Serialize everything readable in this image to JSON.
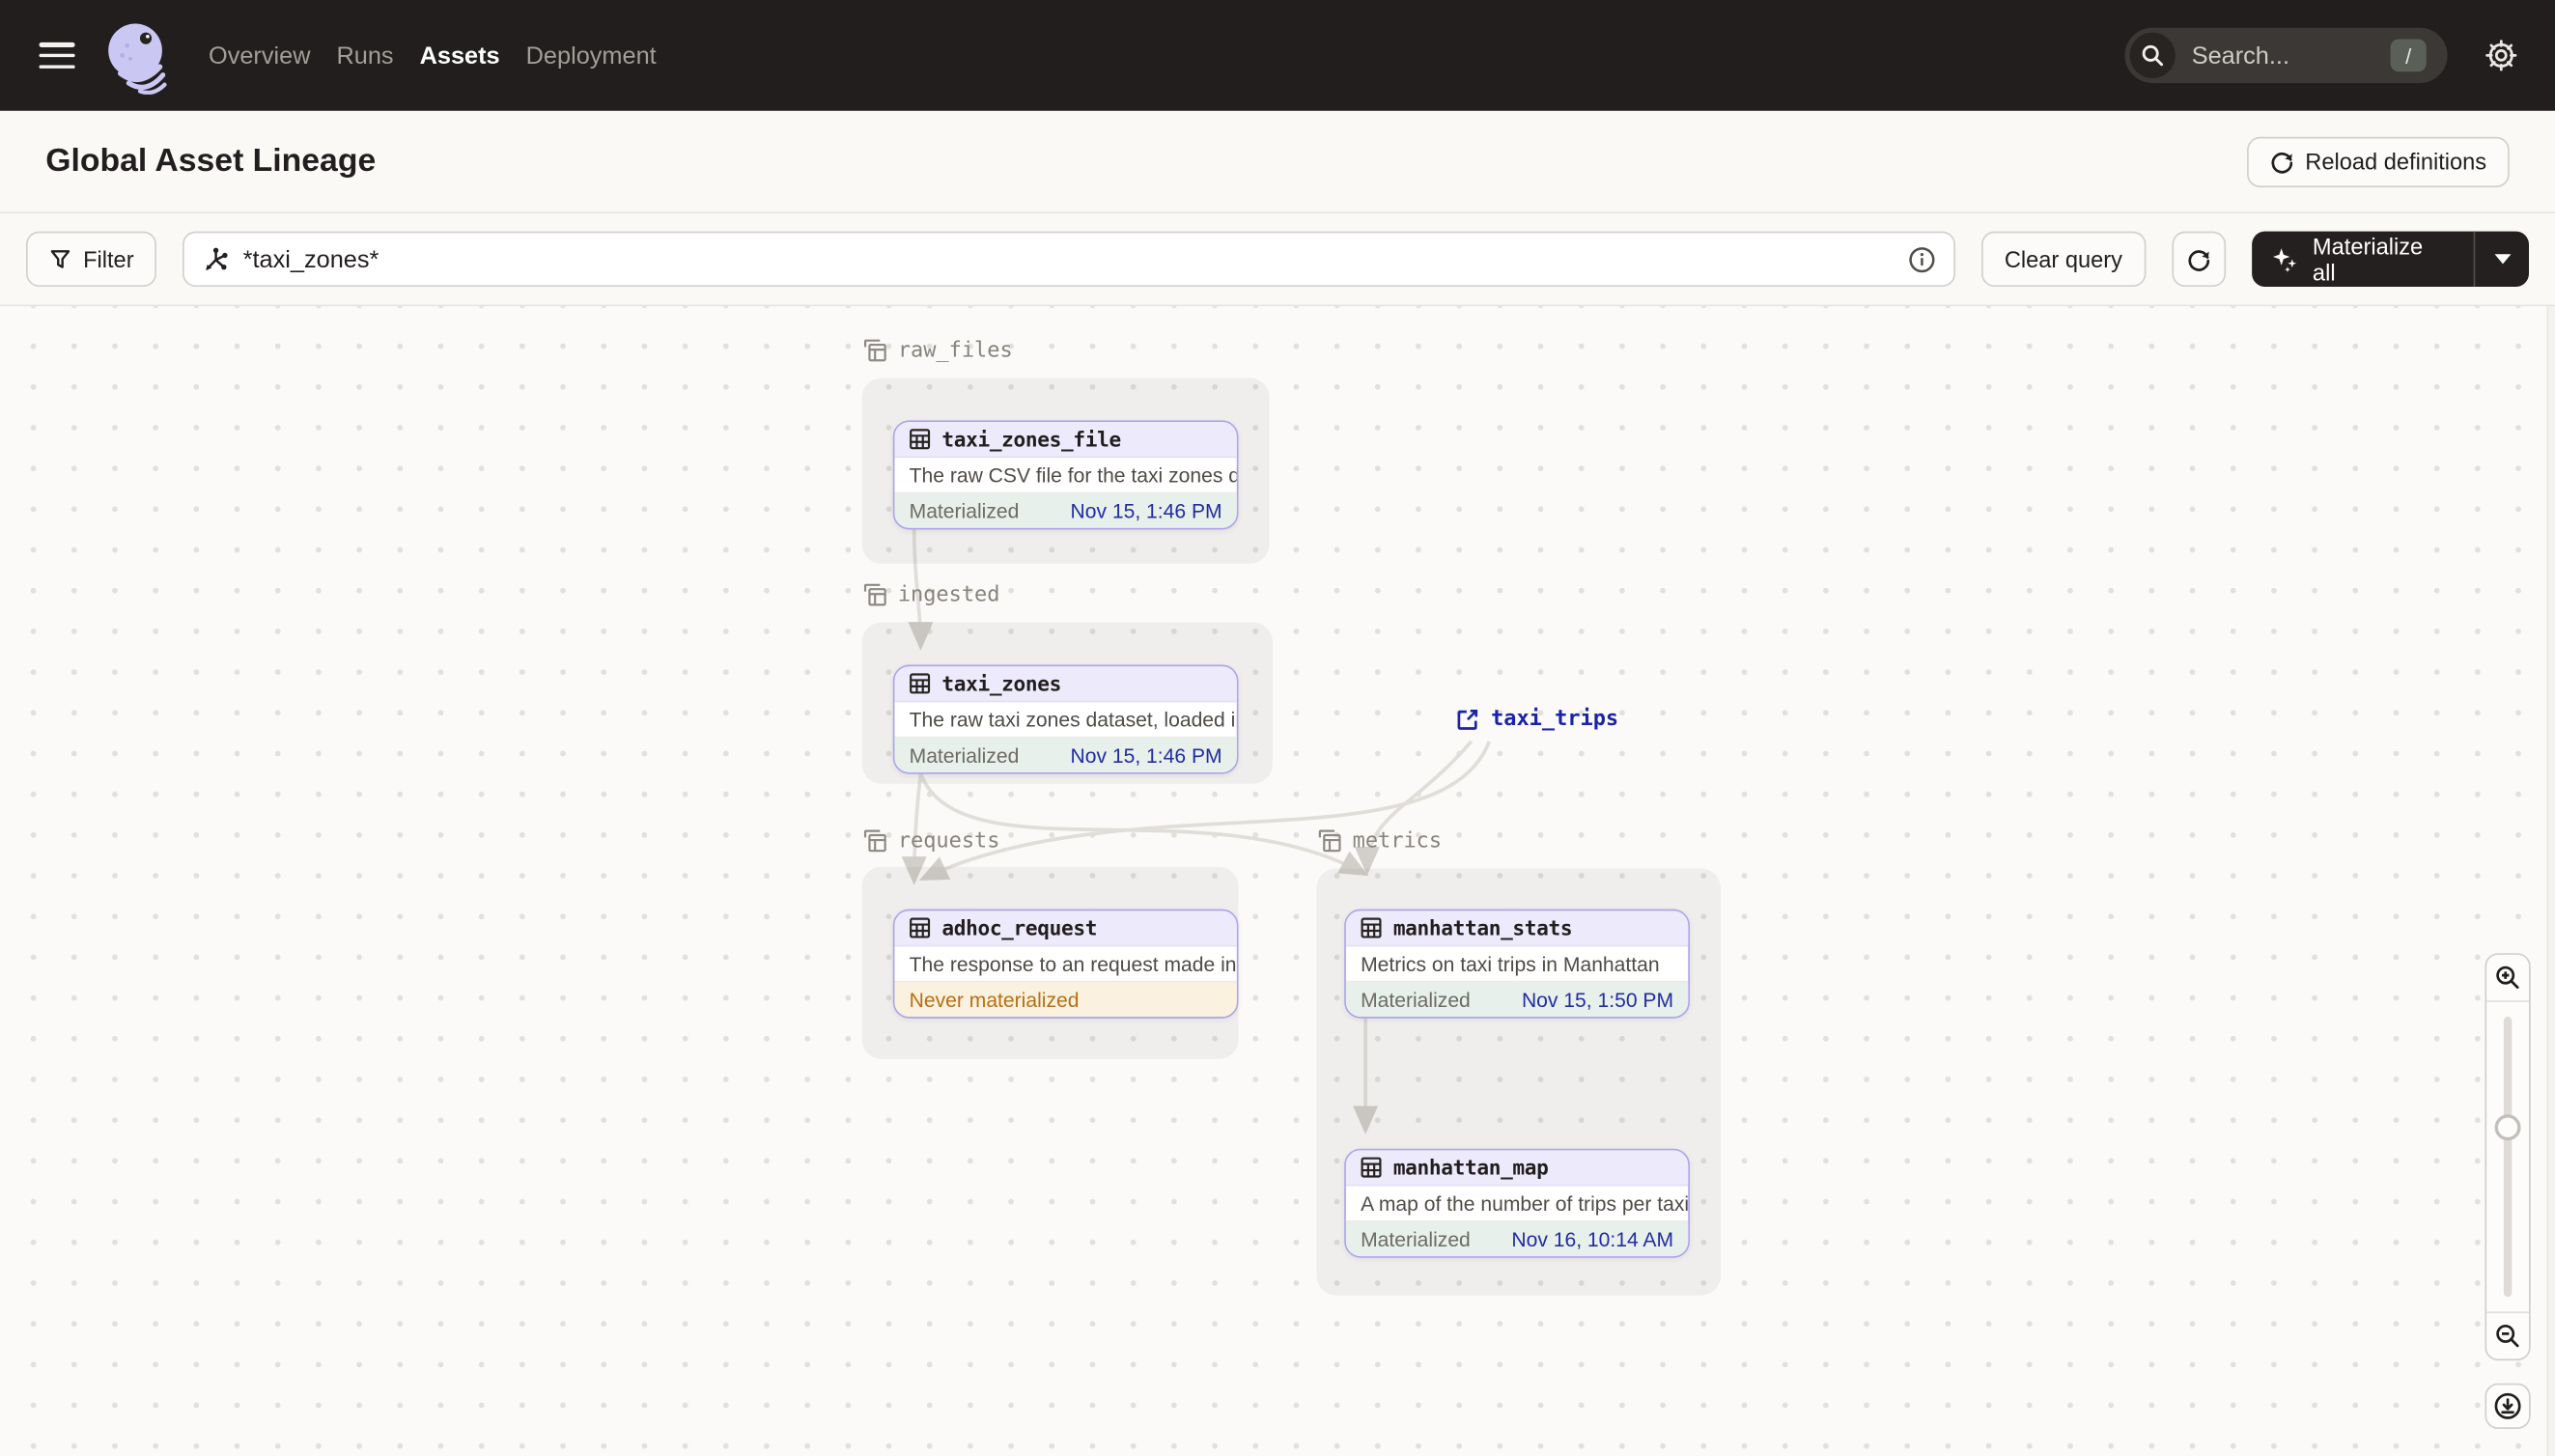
{
  "nav": {
    "items": [
      {
        "label": "Overview",
        "active": false
      },
      {
        "label": "Runs",
        "active": false
      },
      {
        "label": "Assets",
        "active": true
      },
      {
        "label": "Deployment",
        "active": false
      }
    ],
    "search": {
      "placeholder": "Search...",
      "shortcut_key": "/"
    }
  },
  "header": {
    "title": "Global Asset Lineage",
    "reload_button_label": "Reload definitions"
  },
  "toolbar": {
    "filter_button_label": "Filter",
    "query_value": "*taxi_zones*",
    "clear_button_label": "Clear query",
    "materialize_button_label": "Materialize all"
  },
  "graph": {
    "groups": [
      {
        "label": "raw_files"
      },
      {
        "label": "ingested"
      },
      {
        "label": "requests"
      },
      {
        "label": "metrics"
      }
    ],
    "assets": [
      {
        "name": "taxi_zones_file",
        "group": "raw_files",
        "description": "The raw CSV file for the taxi zones dat...",
        "status": "Materialized",
        "timestamp": "Nov 15, 1:46 PM",
        "state": "materialized"
      },
      {
        "name": "taxi_zones",
        "group": "ingested",
        "description": "The raw taxi zones dataset, loaded int...",
        "status": "Materialized",
        "timestamp": "Nov 15, 1:46 PM",
        "state": "materialized"
      },
      {
        "name": "adhoc_request",
        "group": "requests",
        "description": "The response to an request made in th...",
        "status": "Never materialized",
        "timestamp": "",
        "state": "never"
      },
      {
        "name": "manhattan_stats",
        "group": "metrics",
        "description": "Metrics on taxi trips in Manhattan",
        "status": "Materialized",
        "timestamp": "Nov 15, 1:50 PM",
        "state": "materialized"
      },
      {
        "name": "manhattan_map",
        "group": "metrics",
        "description": "A map of the number of trips per taxi z...",
        "status": "Materialized",
        "timestamp": "Nov 16, 10:14 AM",
        "state": "materialized"
      }
    ],
    "external_assets": [
      {
        "name": "taxi_trips"
      }
    ],
    "edges": [
      {
        "from": "taxi_zones_file",
        "to": "taxi_zones"
      },
      {
        "from": "taxi_zones",
        "to": "adhoc_request"
      },
      {
        "from": "taxi_zones",
        "to": "manhattan_stats"
      },
      {
        "from": "taxi_trips",
        "to": "adhoc_request"
      },
      {
        "from": "taxi_trips",
        "to": "manhattan_stats"
      },
      {
        "from": "manhattan_stats",
        "to": "manhattan_map"
      }
    ]
  },
  "icons": {
    "menu": "hamburger",
    "logo": "dagster-octopus",
    "search": "magnifier",
    "settings": "gear",
    "reload": "refresh-arrow",
    "filter": "funnel",
    "query": "asset-graph",
    "info": "info-circle",
    "refresh": "refresh-arrow",
    "materialize": "sparkle",
    "expand": "caret-down",
    "group": "stacked-tables",
    "asset": "table-grid",
    "external": "external-link",
    "zoom_in": "magnifier-plus",
    "zoom_out": "magnifier-minus",
    "export": "download-circle"
  },
  "colors": {
    "nav_bg": "#211E1D",
    "page_bg": "#FAF9F6",
    "canvas_bg": "#FBFAF8",
    "node_border": "#ACA5E9",
    "node_header_bg": "#EDEBFB",
    "materialized_bg": "#E7F0EA",
    "never_materialized_bg": "#FAF1DE",
    "timestamp_text": "#222CA3",
    "never_text": "#B66F15",
    "dark_button_bg": "#24201F",
    "external_link_text": "#1B24A4",
    "edge": "#E1DEDA",
    "group_label_text": "#87837D"
  }
}
